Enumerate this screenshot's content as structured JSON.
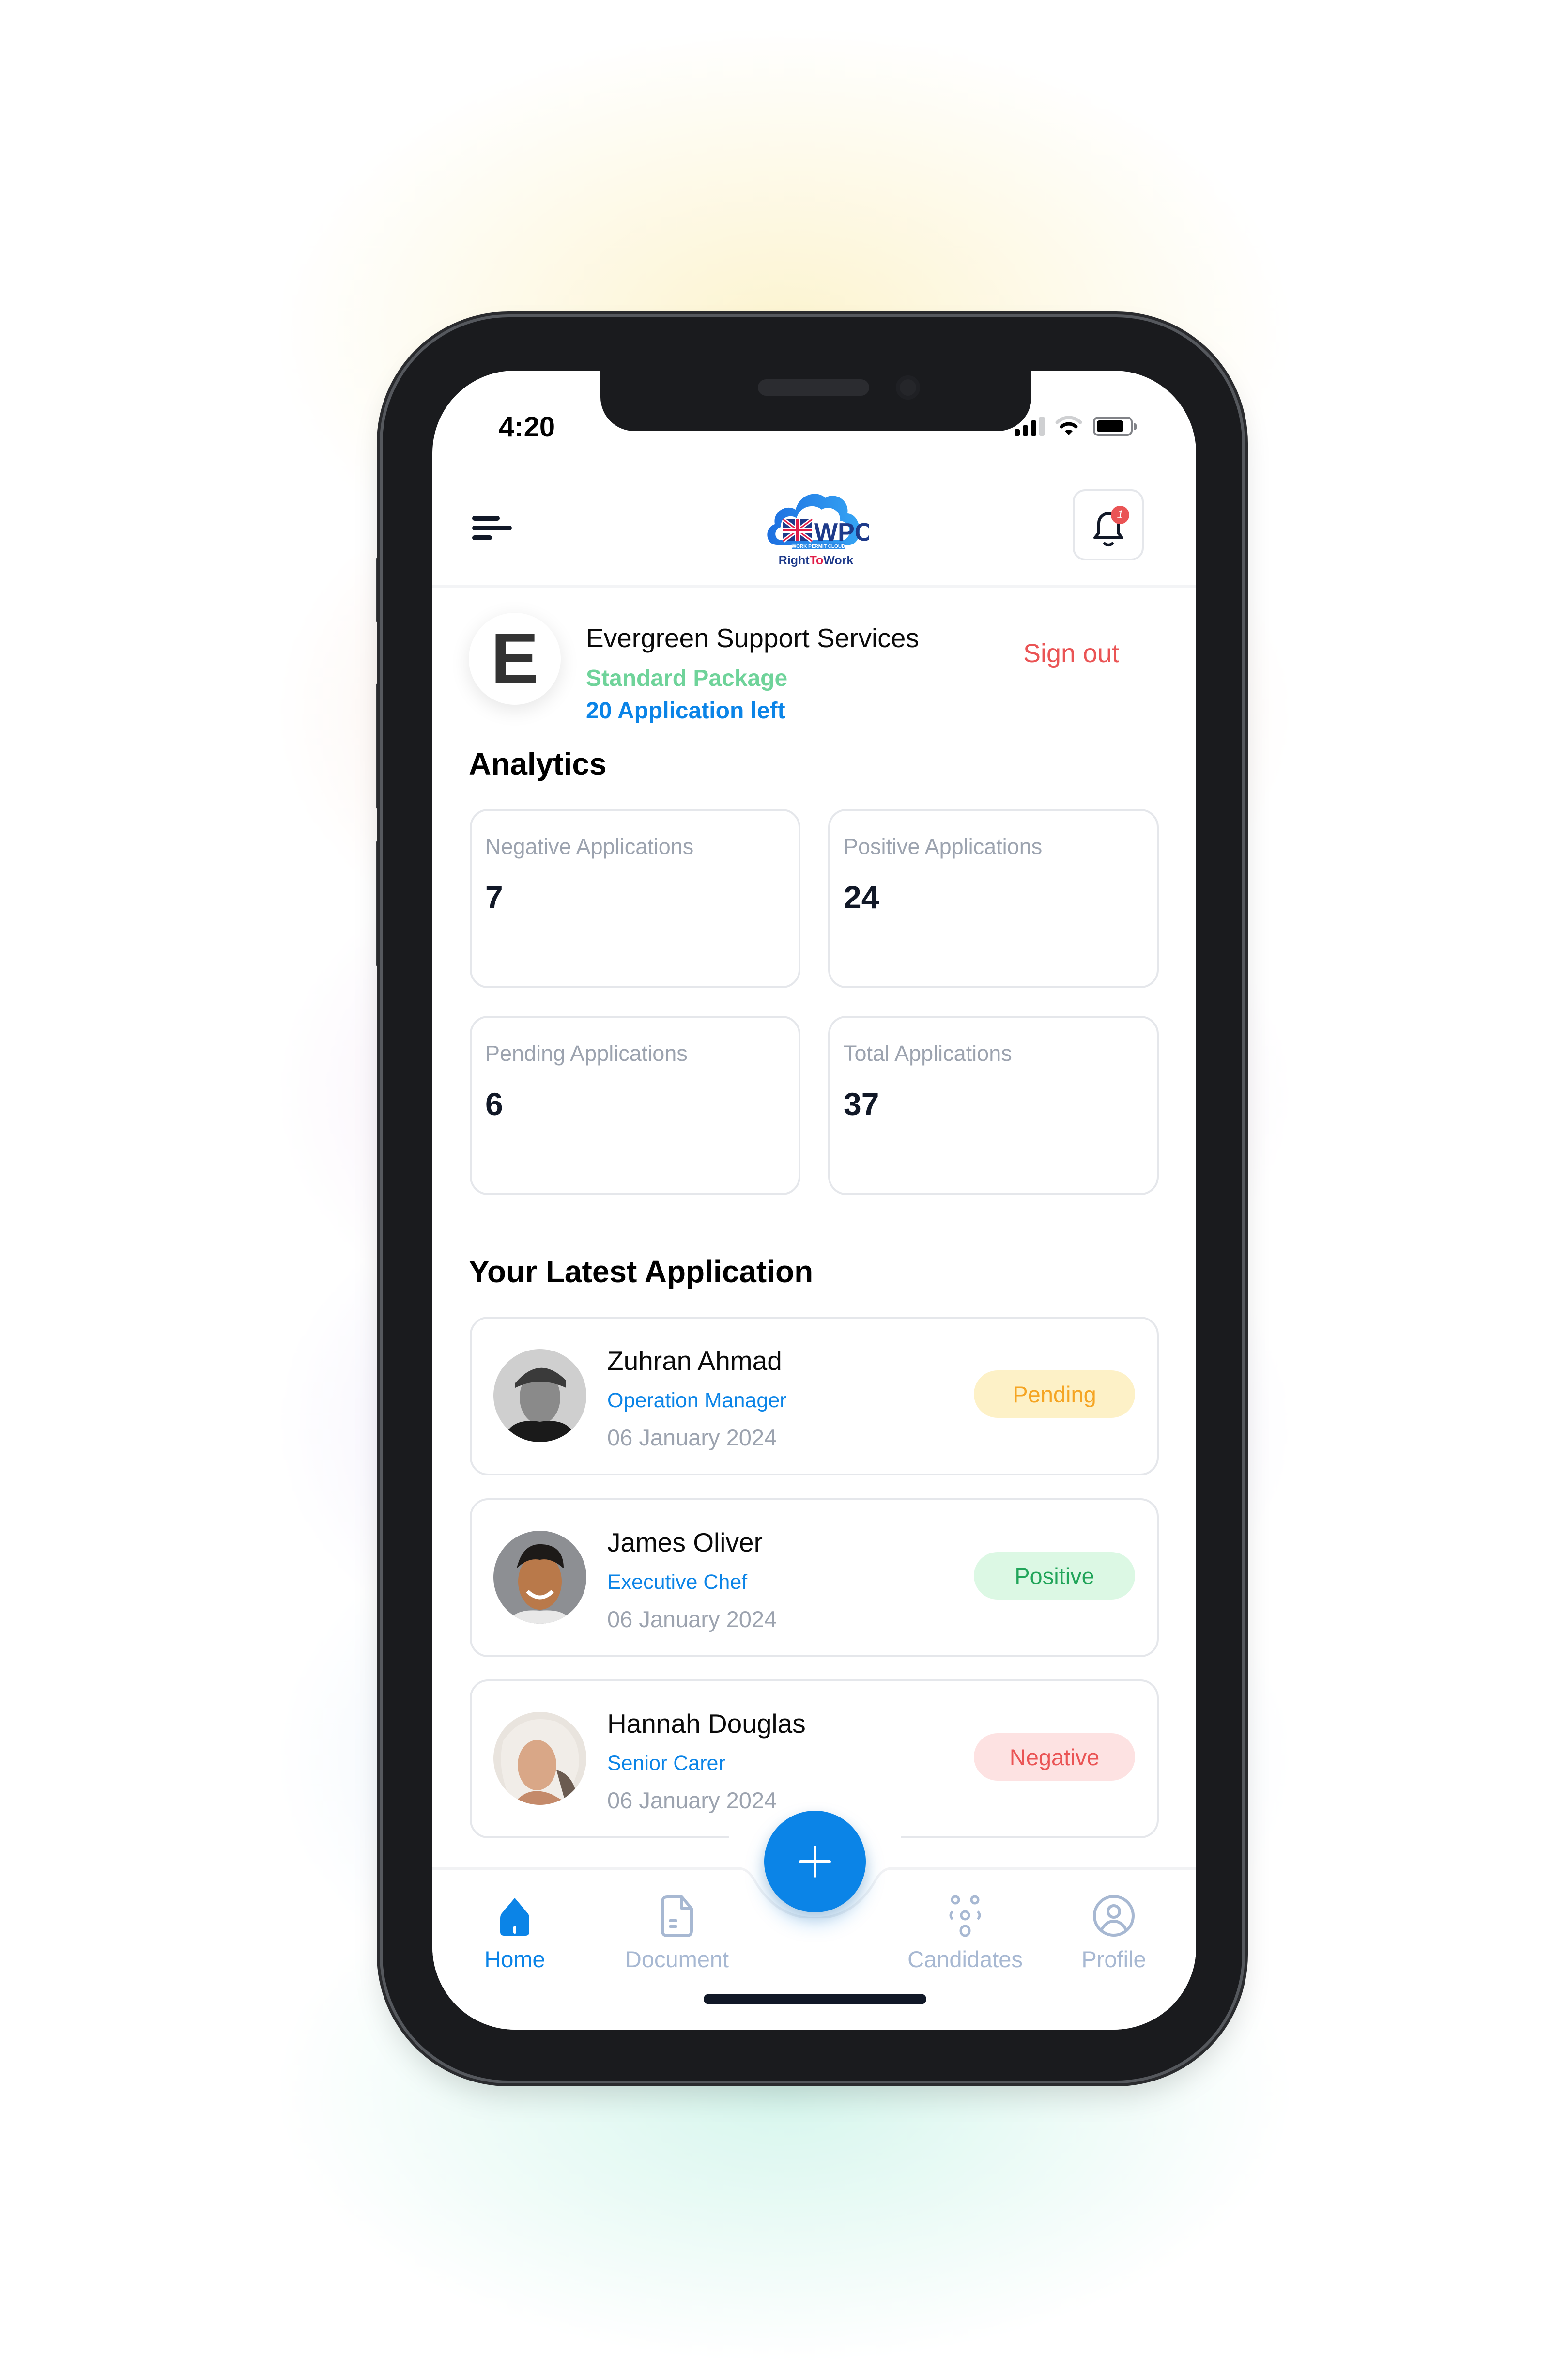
{
  "status_bar": {
    "time": "4:20",
    "signal_bars_active": 3,
    "signal_bars_total": 4,
    "wifi_icon": "wifi-icon",
    "battery_level": 0.85
  },
  "header": {
    "menu_icon": "hamburger-menu-icon",
    "logo": {
      "main_letters": "WPC",
      "tagline": "WORK PERMIT CLOUD",
      "brand_right": "Right",
      "brand_to": "To",
      "brand_work": "Work"
    },
    "notification_icon": "bell-icon",
    "notification_count": "1"
  },
  "company": {
    "initial": "E",
    "name": "Evergreen Support Services",
    "package": "Standard Package",
    "applications_left": "20 Application left",
    "sign_out_label": "Sign out"
  },
  "analytics": {
    "title": "Analytics",
    "cards": [
      {
        "label": "Negative Applications",
        "value": "7"
      },
      {
        "label": "Positive Applications",
        "value": "24"
      },
      {
        "label": "Pending Applications",
        "value": "6"
      },
      {
        "label": "Total Applications",
        "value": "37"
      }
    ]
  },
  "latest": {
    "title": "Your Latest Application",
    "applications": [
      {
        "name": "Zuhran Ahmad",
        "role": "Operation Manager",
        "date": "06 January 2024",
        "status": "Pending"
      },
      {
        "name": "James Oliver",
        "role": "Executive Chef",
        "date": "06 January 2024",
        "status": "Positive"
      },
      {
        "name": "Hannah Douglas",
        "role": "Senior Carer",
        "date": "06 January 2024",
        "status": "Negative"
      }
    ]
  },
  "status_colors": {
    "Pending": {
      "bg": "#fdf1c7",
      "fg": "#f5a524"
    },
    "Positive": {
      "bg": "#dcf8e4",
      "fg": "#22a55a"
    },
    "Negative": {
      "bg": "#fde2e2",
      "fg": "#ea5455"
    }
  },
  "fab": {
    "icon": "plus-icon"
  },
  "bottom_nav": {
    "items": [
      {
        "label": "Home",
        "icon": "home-icon",
        "active": true
      },
      {
        "label": "Document",
        "icon": "document-icon",
        "active": false
      },
      {
        "label": "Candidates",
        "icon": "candidates-icon",
        "active": false
      },
      {
        "label": "Profile",
        "icon": "profile-icon",
        "active": false
      }
    ]
  },
  "colors": {
    "accent": "#0b84e7",
    "nav_inactive": "#a7b8d2",
    "package_green": "#6fd39a",
    "danger": "#ea5455"
  }
}
